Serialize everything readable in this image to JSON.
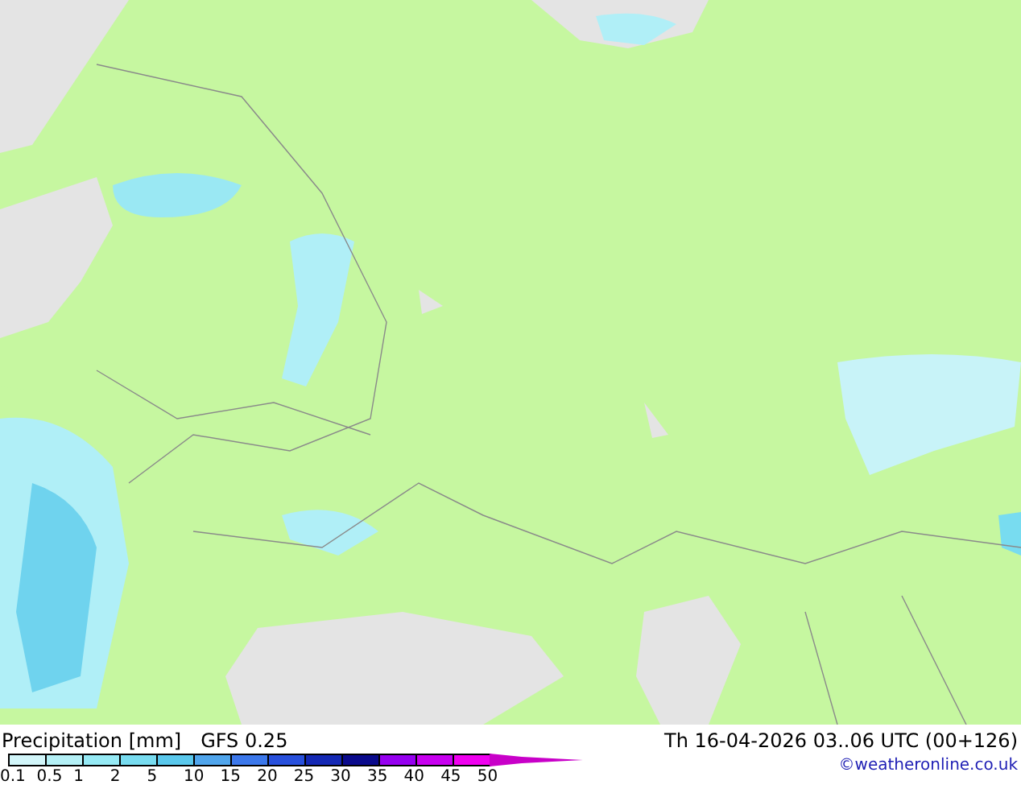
{
  "map": {
    "title": "Precipitation [mm]",
    "model": "GFS 0.25",
    "valid_time": "Th 16-04-2026 03..06 UTC (00+126)",
    "credit": "©weatheronline.co.uk"
  },
  "legend": {
    "segments": [
      {
        "color": "#d2f6fa"
      },
      {
        "color": "#b4f0f6"
      },
      {
        "color": "#96eaf5"
      },
      {
        "color": "#78dcf0"
      },
      {
        "color": "#5ac8ec"
      },
      {
        "color": "#50a5ec"
      },
      {
        "color": "#3c78eb"
      },
      {
        "color": "#2850dc"
      },
      {
        "color": "#1428b4"
      },
      {
        "color": "#0a0a8c"
      },
      {
        "color": "#9600f0"
      },
      {
        "color": "#c800f0"
      },
      {
        "color": "#f000f0"
      },
      {
        "color": "#c800c8"
      }
    ],
    "ticks": [
      "0.1",
      "0.5",
      "1",
      "2",
      "5",
      "10",
      "15",
      "20",
      "25",
      "30",
      "35",
      "40",
      "45",
      "50"
    ]
  }
}
